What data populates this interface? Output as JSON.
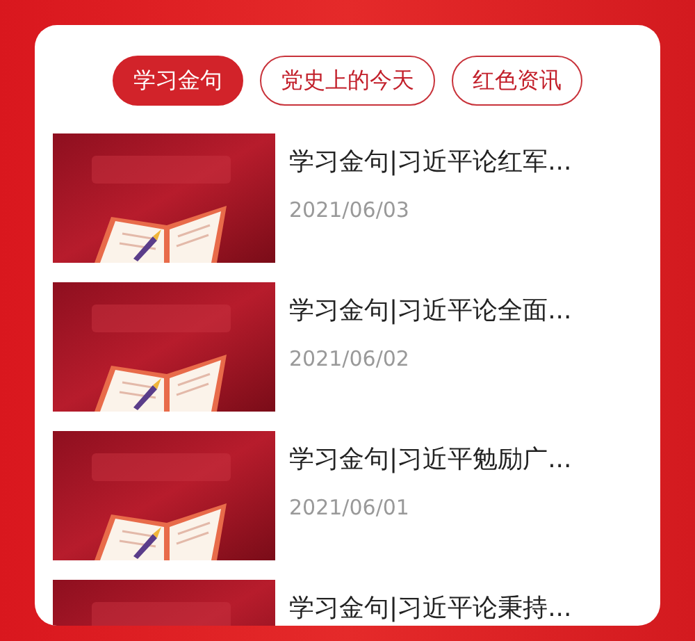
{
  "tabs": [
    {
      "label": "学习金句",
      "selected": true
    },
    {
      "label": "党史上的今天",
      "selected": false
    },
    {
      "label": "红色资讯",
      "selected": false
    }
  ],
  "articles": [
    {
      "title": "学习金句|习近平论红军...",
      "date": "2021/06/03"
    },
    {
      "title": "学习金句|习近平论全面...",
      "date": "2021/06/02"
    },
    {
      "title": "学习金句|习近平勉励广...",
      "date": "2021/06/01"
    },
    {
      "title": "学习金句|习近平论秉持..."
    }
  ]
}
